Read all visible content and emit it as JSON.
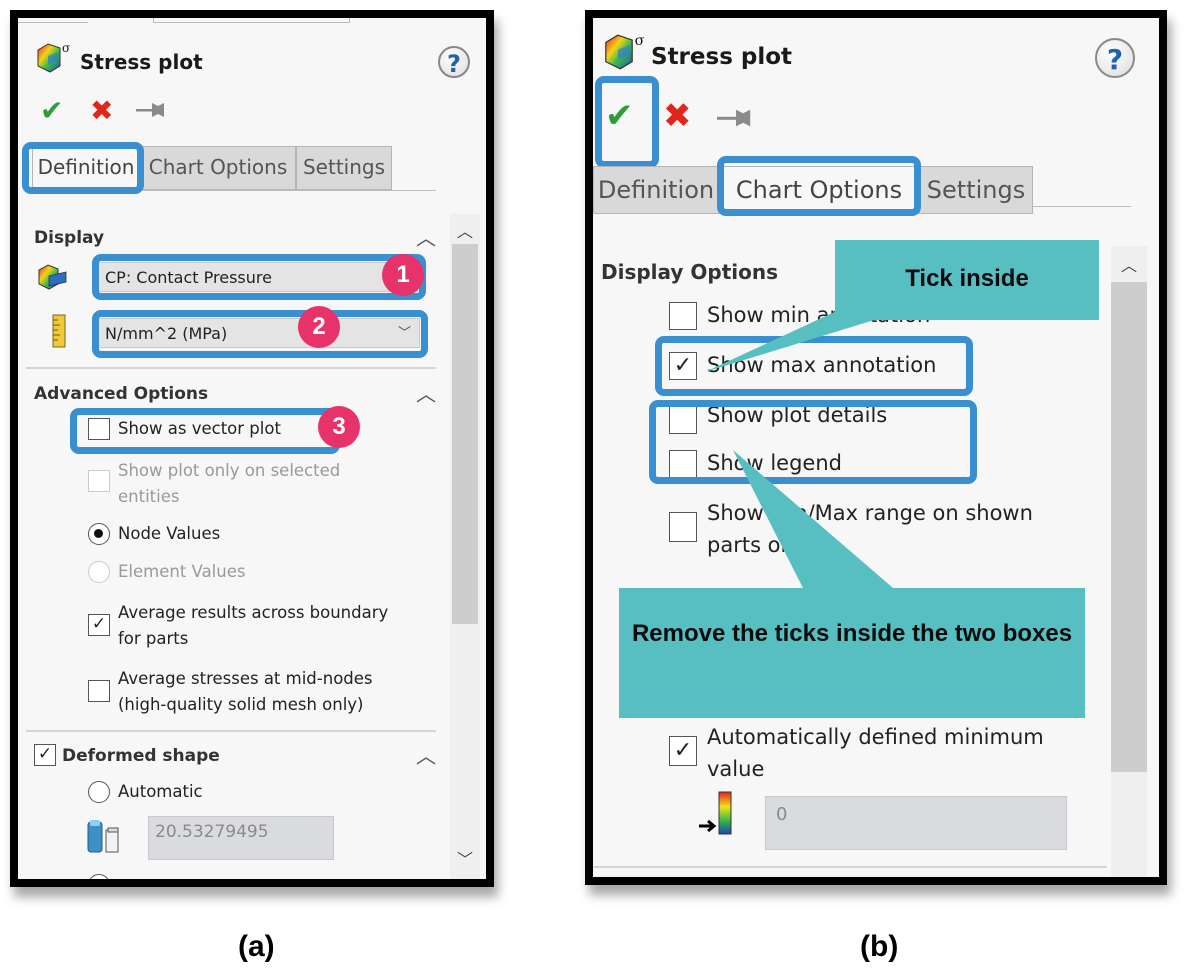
{
  "panel_a": {
    "title": "Stress plot",
    "help_label": "?",
    "tabs": [
      {
        "label": "Definition",
        "active": true
      },
      {
        "label": "Chart Options",
        "active": false
      },
      {
        "label": "Settings",
        "active": false
      }
    ],
    "display": {
      "heading": "Display",
      "result_field": "CP: Contact Pressure",
      "units_select": "N/mm^2 (MPa)"
    },
    "advanced": {
      "heading": "Advanced Options",
      "show_vector_plot": "Show as vector plot",
      "show_selected_line1": "Show plot only on selected",
      "show_selected_line2": "entities",
      "node_values": "Node Values",
      "element_values": "Element Values",
      "avg_boundary_line1": "Average results across boundary",
      "avg_boundary_line2": "for parts",
      "avg_mid_line1": "Average stresses at mid-nodes",
      "avg_mid_line2": "(high-quality solid mesh only)"
    },
    "deformed": {
      "heading": "Deformed shape",
      "automatic": "Automatic",
      "scale_value": "20.53279495"
    },
    "badges": [
      "1",
      "2",
      "3"
    ],
    "caption": "(a)"
  },
  "panel_b": {
    "title": "Stress plot",
    "help_label": "?",
    "tabs": [
      {
        "label": "Definition",
        "active": false
      },
      {
        "label": "Chart Options",
        "active": true
      },
      {
        "label": "Settings",
        "active": false
      }
    ],
    "display_options": {
      "heading": "Display Options",
      "show_min": "Show min annotation",
      "show_max": "Show max annotation",
      "show_plot_details": "Show plot details",
      "show_legend": "Show legend",
      "minmax_line1": "Show Min/Max range on shown",
      "minmax_line2": "parts only",
      "auto_min_line1": "Automatically defined minimum",
      "auto_min_line2": "value",
      "min_value": "0"
    },
    "callouts": {
      "tick_inside": "Tick inside",
      "remove_ticks": "Remove the ticks inside the two boxes"
    },
    "caption": "(b)"
  },
  "colors": {
    "highlight_blue": "#3a8fd0",
    "badge_pink": "#e8326a",
    "callout_teal": "#57bec2",
    "ok_green": "#2e9c3b",
    "cancel_red": "#e0261c"
  }
}
